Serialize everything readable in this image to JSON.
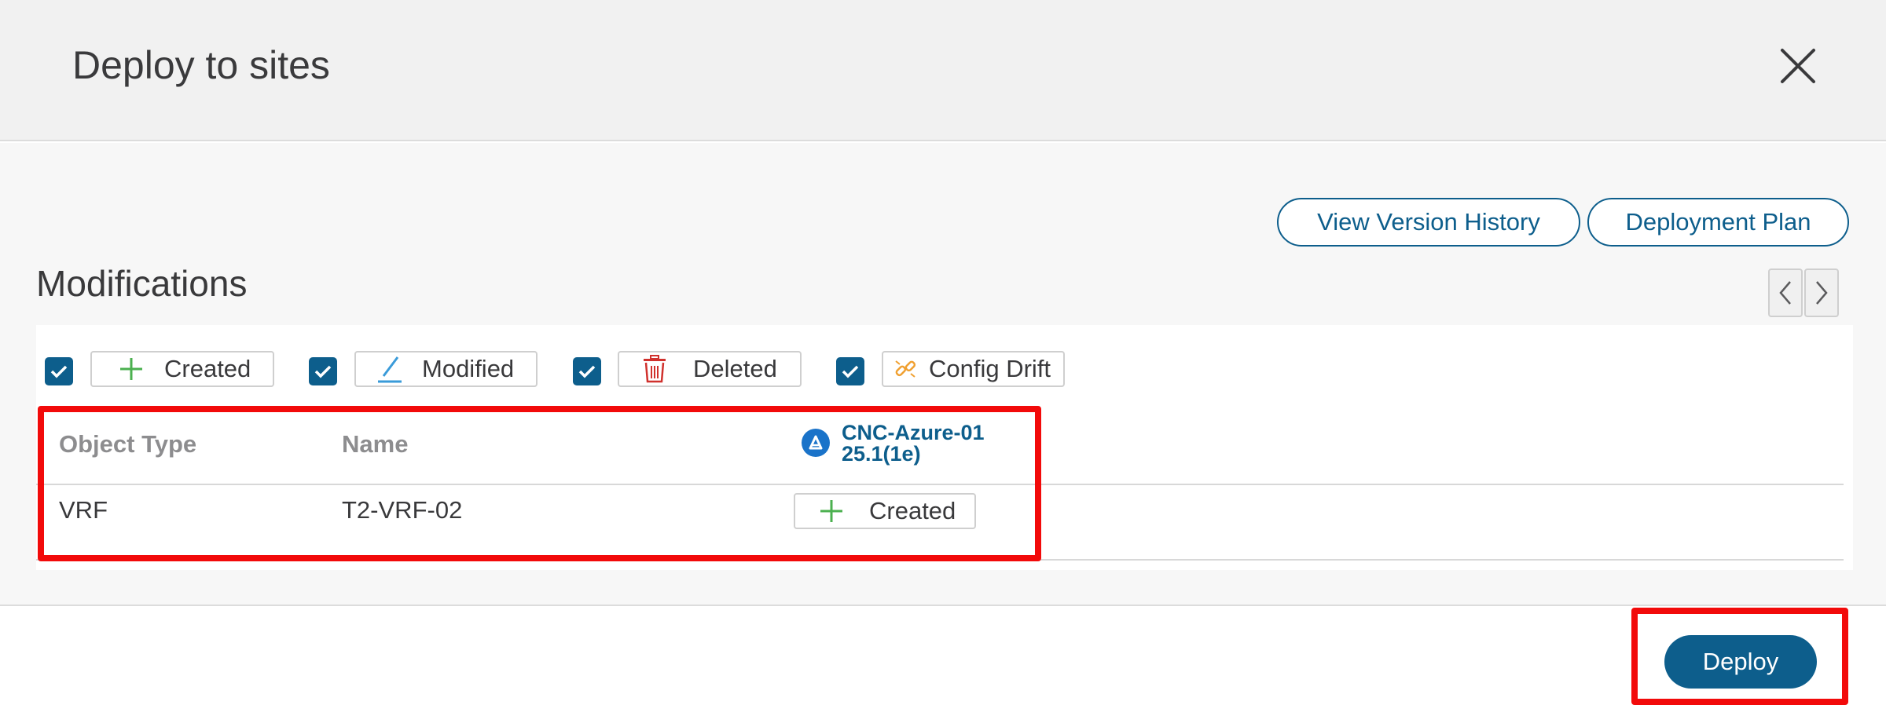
{
  "dialog": {
    "title": "Deploy to sites",
    "close_icon": "close-icon"
  },
  "toolbar": {
    "view_version_history": "View Version History",
    "deployment_plan": "Deployment Plan"
  },
  "modifications": {
    "title": "Modifications",
    "filters": [
      {
        "label": "Created",
        "checked": true,
        "icon": "plus-icon",
        "icon_color": "#4bb04f"
      },
      {
        "label": "Modified",
        "checked": true,
        "icon": "pencil-icon",
        "icon_color": "#3a9bd9"
      },
      {
        "label": "Deleted",
        "checked": true,
        "icon": "trash-icon",
        "icon_color": "#d0312d"
      },
      {
        "label": "Config Drift",
        "checked": true,
        "icon": "broken-link-icon",
        "icon_color": "#f0a030"
      }
    ]
  },
  "table": {
    "columns": {
      "object_type": "Object Type",
      "name": "Name"
    },
    "site": {
      "name": "CNC-Azure-01",
      "version": "25.1(1e)",
      "icon": "azure-icon"
    },
    "rows": [
      {
        "object_type": "VRF",
        "name": "T2-VRF-02",
        "status": "Created"
      }
    ]
  },
  "footer": {
    "deploy": "Deploy"
  },
  "colors": {
    "primary": "#0d5e8c",
    "highlight": "#f20a0a",
    "created_green": "#4bb04f"
  }
}
